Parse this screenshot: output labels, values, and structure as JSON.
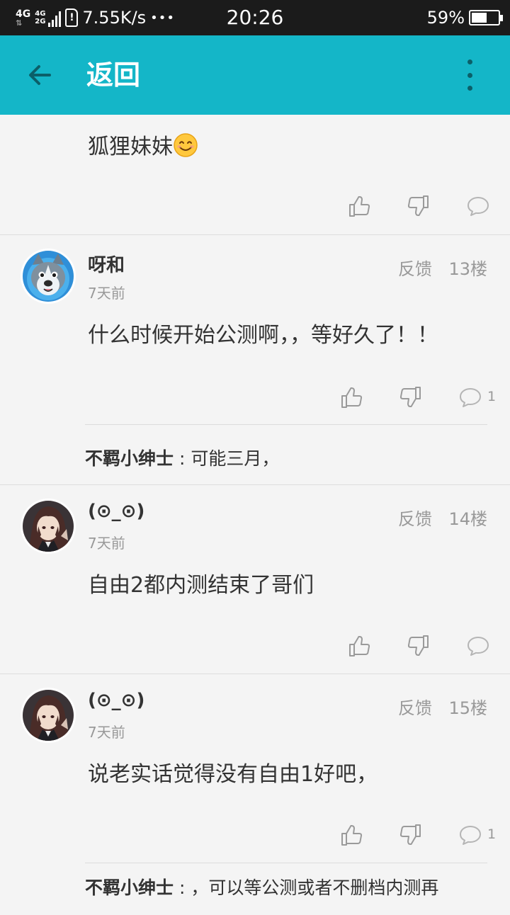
{
  "status_bar": {
    "network": "4G",
    "network_small_top": "4G",
    "network_small_bottom": "2G",
    "speed": "7.55K/s",
    "dots": "•••",
    "time": "20:26",
    "battery_pct": "59%",
    "battery_level": 0.59
  },
  "appbar": {
    "title": "返回",
    "back_icon": "arrow-left-icon",
    "menu_icon": "more-vert-icon",
    "color": "#14b6c8"
  },
  "first_post": {
    "body": "狐狸妹妹",
    "emoji": "smile-emoji"
  },
  "posts": [
    {
      "user": "呀和",
      "time": "7天前",
      "feedback": "反馈",
      "floor": "13楼",
      "body": "什么时候开始公测啊，，等好久了！！",
      "comment_count": "1",
      "reply_user": "不羁小绅士",
      "reply_sep": " : ",
      "reply_text": "可能三月，"
    },
    {
      "user": "(⊙_⊙)",
      "time": "7天前",
      "feedback": "反馈",
      "floor": "14楼",
      "body": "自由2都内测结束了哥们"
    },
    {
      "user": "(⊙_⊙)",
      "time": "7天前",
      "feedback": "反馈",
      "floor": "15楼",
      "body": "说老实话觉得没有自由1好吧，",
      "comment_count": "1",
      "reply_user": "不羁小绅士",
      "reply_sep": " : ",
      "reply_text": "，可以等公测或者不删档内测再"
    }
  ]
}
